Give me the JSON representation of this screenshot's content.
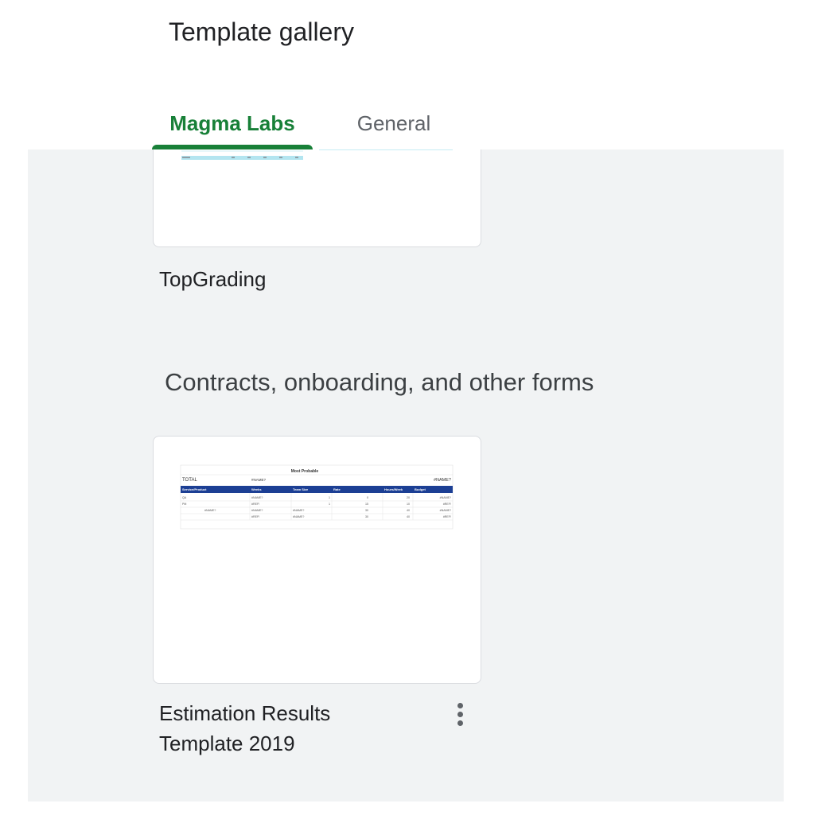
{
  "header": {
    "title": "Template gallery"
  },
  "tabs": [
    {
      "label": "Magma Labs",
      "active": true
    },
    {
      "label": "General",
      "active": false
    }
  ],
  "cards": [
    {
      "title": "TopGrading"
    },
    {
      "title_line1": "Estimation Results",
      "title_line2": "Template 2019"
    }
  ],
  "sections": [
    {
      "heading": "Contracts, onboarding, and other forms"
    }
  ],
  "thumbnail_estimation": {
    "caption": "Most Probable",
    "total_label": "TOTAL",
    "total_value": "#NAME?",
    "total_right": "#NAME?",
    "columns": [
      "Service/Product",
      "Weeks",
      "Team Size",
      "Rate",
      "Hours/Week",
      "Budget"
    ],
    "rows": [
      [
        "QA",
        "#NAME?",
        "1",
        "0",
        "20",
        "#NAME?"
      ],
      [
        "PM",
        "#REF!",
        "1",
        "15",
        "10",
        "#REF!"
      ],
      [
        "#NAME?",
        "#NAME?",
        "#NAME?",
        "30",
        "40",
        "#NAME?"
      ],
      [
        "",
        "#REF!",
        "#NAME?",
        "30",
        "40",
        "#REF!"
      ]
    ]
  },
  "colors": {
    "accent": "#188038",
    "content_bg": "#f1f3f4",
    "table_header": "#1c3f94",
    "thumb_line": "#b3e5f0"
  },
  "icons": {
    "more": "more-vert-icon"
  }
}
